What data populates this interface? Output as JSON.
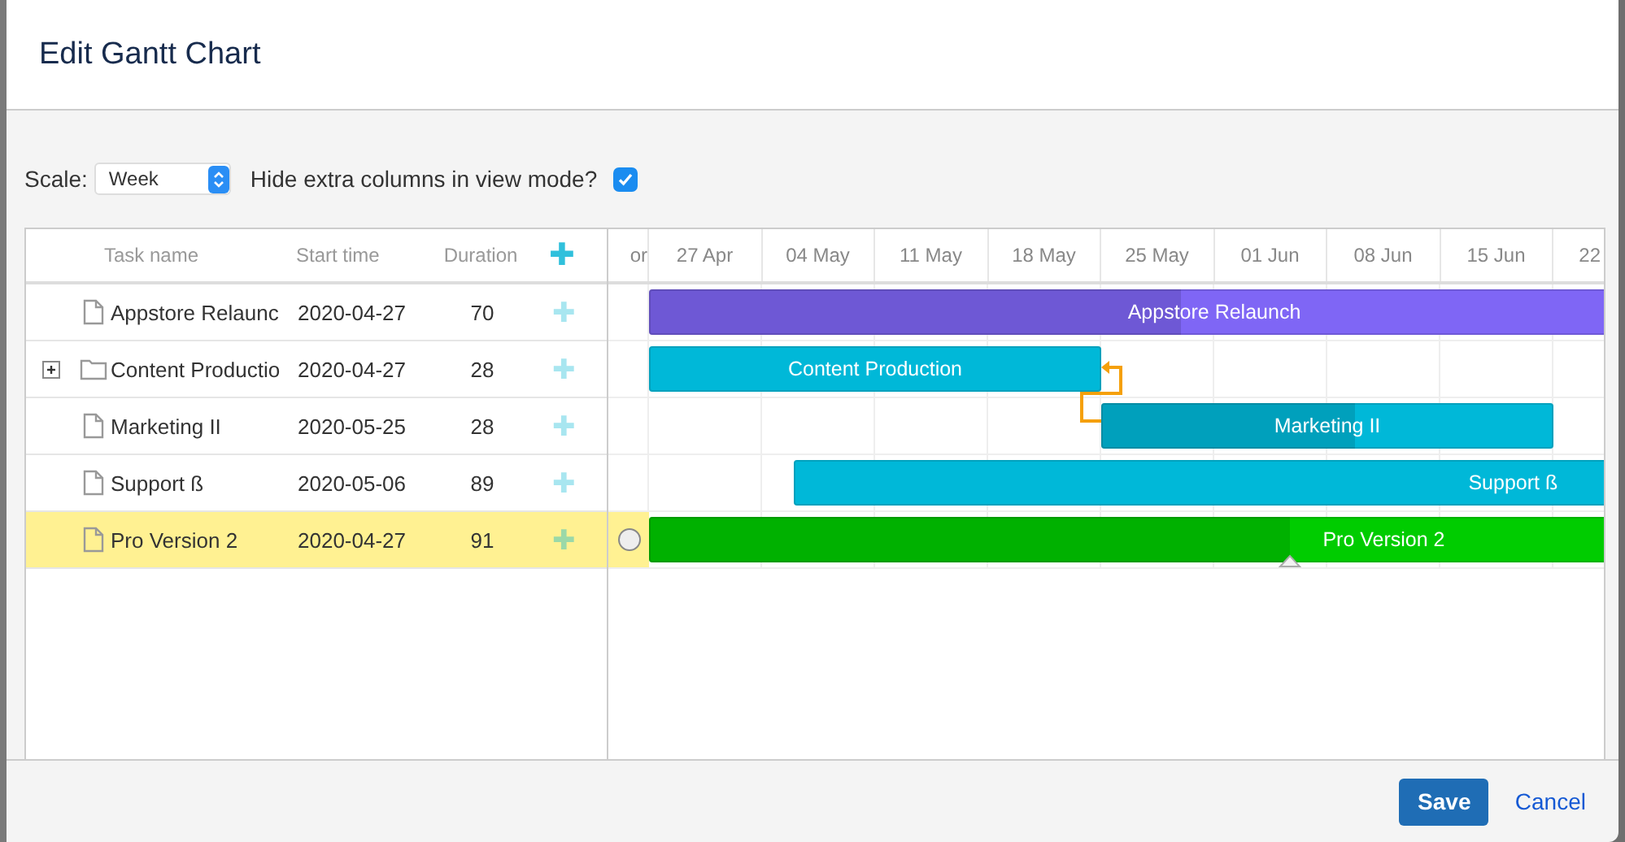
{
  "dialog": {
    "title": "Edit Gantt Chart"
  },
  "scale": {
    "label": "Scale:",
    "value": "Week"
  },
  "hide_columns": {
    "label": "Hide extra columns in view mode?",
    "checked": true
  },
  "grid": {
    "columns": [
      "Task name",
      "Start time",
      "Duration"
    ],
    "add_icon": "✚"
  },
  "timeline": {
    "weeks": [
      "or",
      "27 Apr",
      "04 May",
      "11 May",
      "18 May",
      "25 May",
      "01 Jun",
      "08 Jun",
      "15 Jun",
      "22"
    ]
  },
  "tasks": [
    {
      "name": "Appstore Relaunc",
      "bar_label": "Appstore Relaunch",
      "start_time": "2020-04-27",
      "duration": "70",
      "kind": "file",
      "color": "#7f66f5",
      "level": 0.47,
      "selected": false
    },
    {
      "name": "Content Productio",
      "bar_label": "Content Production",
      "start_time": "2020-04-27",
      "duration": "28",
      "kind": "folder",
      "expanded": false,
      "color": "#00b8d8",
      "selected": false
    },
    {
      "name": "Marketing II",
      "bar_label": "Marketing II",
      "start_time": "2020-05-25",
      "duration": "28",
      "kind": "file",
      "color": "#00b8d8",
      "level": 0.56,
      "selected": false,
      "linked_to_previous": true
    },
    {
      "name": "Support ß",
      "bar_label": "Support ß",
      "start_time": "2020-05-06",
      "duration": "89",
      "kind": "file",
      "color": "#00b8d8",
      "selected": false
    },
    {
      "name": "Pro Version 2",
      "bar_label": "Pro Version 2",
      "start_time": "2020-04-27",
      "duration": "91",
      "kind": "file",
      "color": "#00cc00",
      "level": 0.436,
      "selected": true
    }
  ],
  "buttons": {
    "save": "Save",
    "cancel": "Cancel"
  }
}
